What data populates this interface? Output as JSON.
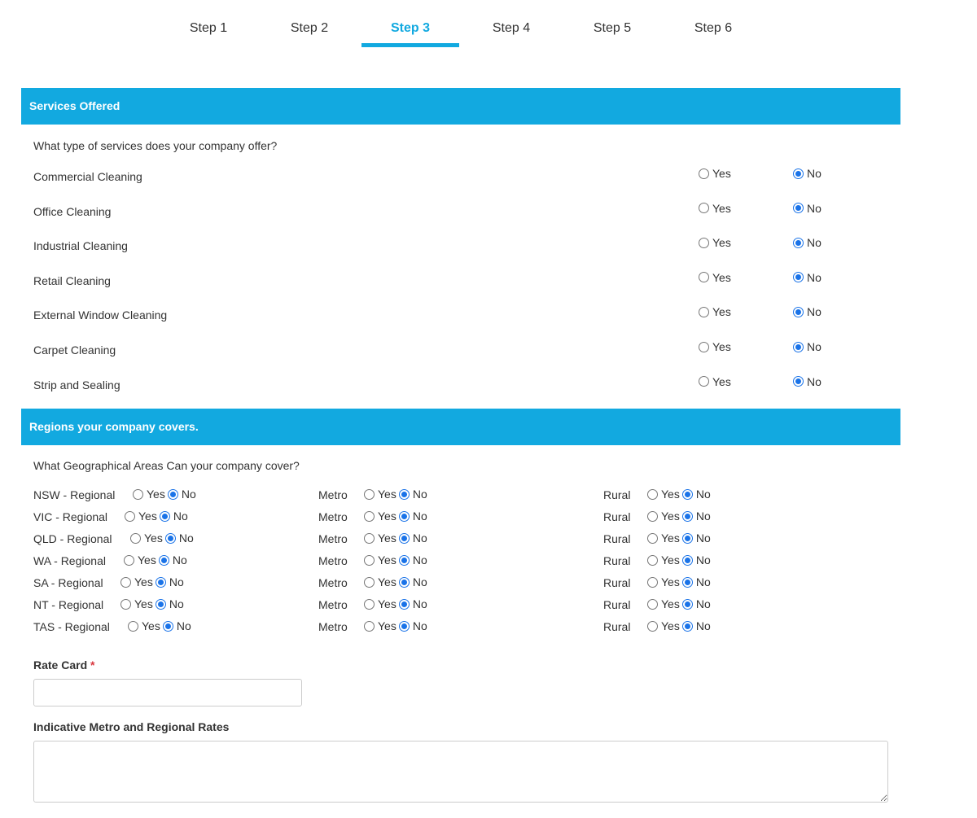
{
  "steps": [
    {
      "label": "Step 1",
      "active": false
    },
    {
      "label": "Step 2",
      "active": false
    },
    {
      "label": "Step 3",
      "active": true
    },
    {
      "label": "Step 4",
      "active": false
    },
    {
      "label": "Step 5",
      "active": false
    },
    {
      "label": "Step 6",
      "active": false
    }
  ],
  "services": {
    "header": "Services Offered",
    "question": "What type of services does your company offer?",
    "yes_label": "Yes",
    "no_label": "No",
    "items": [
      {
        "label": "Commercial Cleaning",
        "value": "No"
      },
      {
        "label": "Office Cleaning",
        "value": "No"
      },
      {
        "label": "Industrial Cleaning",
        "value": "No"
      },
      {
        "label": "Retail Cleaning",
        "value": "No"
      },
      {
        "label": "External Window Cleaning",
        "value": "No"
      },
      {
        "label": "Carpet Cleaning",
        "value": "No"
      },
      {
        "label": "Strip and Sealing",
        "value": "No"
      }
    ]
  },
  "regions": {
    "header": "Regions your company covers.",
    "question": "What Geographical Areas Can your company cover?",
    "yes_label": "Yes",
    "no_label": "No",
    "metro_label": "Metro",
    "rural_label": "Rural",
    "rows": [
      {
        "label": "NSW - Regional",
        "regional": "No",
        "metro": "No",
        "rural": "No"
      },
      {
        "label": "VIC - Regional",
        "regional": "No",
        "metro": "No",
        "rural": "No"
      },
      {
        "label": "QLD - Regional",
        "regional": "No",
        "metro": "No",
        "rural": "No"
      },
      {
        "label": "WA - Regional",
        "regional": "No",
        "metro": "No",
        "rural": "No"
      },
      {
        "label": "SA - Regional",
        "regional": "No",
        "metro": "No",
        "rural": "No"
      },
      {
        "label": "NT - Regional",
        "regional": "No",
        "metro": "No",
        "rural": "No"
      },
      {
        "label": "TAS - Regional",
        "regional": "No",
        "metro": "No",
        "rural": "No"
      }
    ]
  },
  "rate_card": {
    "label": "Rate Card",
    "required_mark": "*",
    "value": ""
  },
  "indicative_rates": {
    "label": "Indicative Metro and Regional Rates",
    "value": ""
  },
  "colors": {
    "accent": "#12a9e0",
    "radio_checked": "#1a73e8",
    "required": "#d9363e"
  }
}
